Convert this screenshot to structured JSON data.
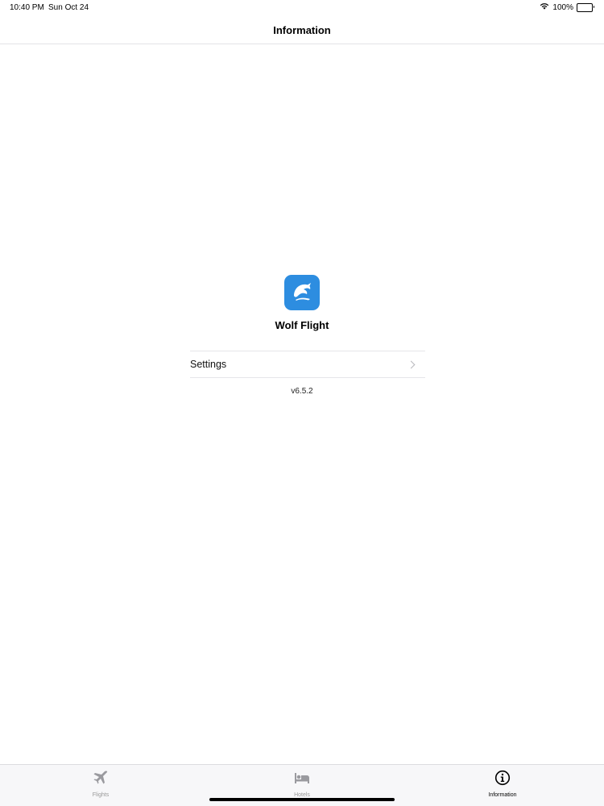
{
  "status_bar": {
    "time": "10:40 PM",
    "date": "Sun Oct 24",
    "battery_text": "100%",
    "icons": [
      "wifi-icon",
      "battery-icon"
    ]
  },
  "nav": {
    "title": "Information"
  },
  "app": {
    "name": "Wolf Flight",
    "icon": "wolf-flight-logo-icon",
    "accent_color": "#2d8de0",
    "version": "v6.5.2"
  },
  "settings": {
    "label": "Settings",
    "icon": "chevron-right-icon"
  },
  "tabs": [
    {
      "label": "Flights",
      "icon": "airplane-icon",
      "selected": false
    },
    {
      "label": "Hotels",
      "icon": "bed-icon",
      "selected": false
    },
    {
      "label": "Information",
      "icon": "info-circle-icon",
      "selected": true
    }
  ]
}
